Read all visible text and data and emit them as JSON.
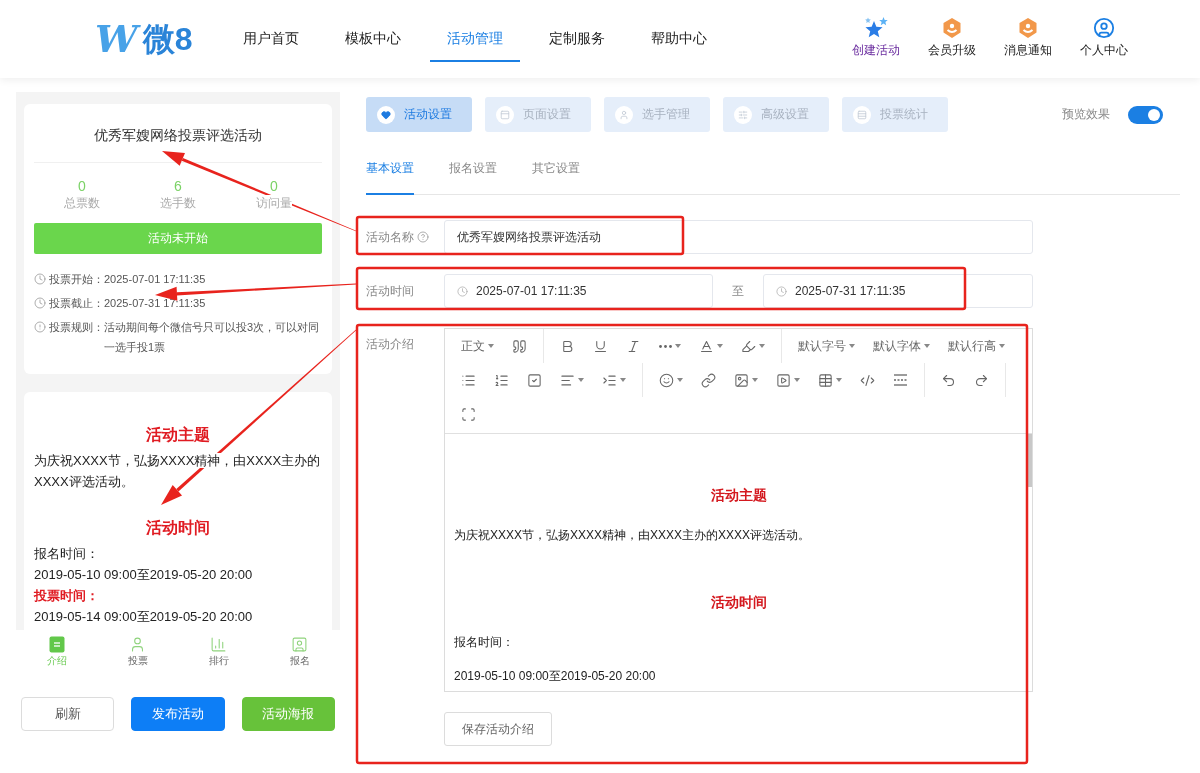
{
  "header": {
    "logo": {
      "mark": "W",
      "text": "微8"
    },
    "nav": [
      {
        "label": "用户首页",
        "selected": false
      },
      {
        "label": "模板中心",
        "selected": false
      },
      {
        "label": "活动管理",
        "selected": true
      },
      {
        "label": "定制服务",
        "selected": false
      },
      {
        "label": "帮助中心",
        "selected": false
      }
    ],
    "actions": [
      {
        "kind": "create",
        "label": "创建活动"
      },
      {
        "kind": "upgrade",
        "label": "会员升级"
      },
      {
        "kind": "notice",
        "label": "消息通知"
      },
      {
        "kind": "profile",
        "label": "个人中心"
      }
    ]
  },
  "preview": {
    "title": "优秀军嫂网络投票评选活动",
    "stats": [
      {
        "value": "0",
        "label": "总票数"
      },
      {
        "value": "6",
        "label": "选手数"
      },
      {
        "value": "0",
        "label": "访问量"
      }
    ],
    "status_button": "活动未开始",
    "info": [
      {
        "kind": "clock",
        "label": "投票开始：",
        "value": "2025-07-01 17:11:35"
      },
      {
        "kind": "clock",
        "label": "投票截止：",
        "value": "2025-07-31 17:11:35"
      },
      {
        "kind": "rule",
        "label": "投票规则：",
        "value": "活动期间每个微信号只可以投3次，可以对同一选手投1票"
      }
    ],
    "intro": [
      {
        "kind": "heading",
        "text": "活动主题"
      },
      {
        "kind": "paragraph",
        "text": "为庆祝XXXX节，弘扬XXXX精神，由XXXX主办的XXXX评选活动。"
      },
      {
        "kind": "heading",
        "text": "活动时间"
      },
      {
        "kind": "paragraph",
        "text": "报名时间："
      },
      {
        "kind": "paragraph",
        "text": "2019-05-10 09:00至2019-05-20 20:00"
      },
      {
        "kind": "emphasis",
        "text": "投票时间："
      },
      {
        "kind": "paragraph",
        "text": "2019-05-14 09:00至2019-05-20 20:00"
      }
    ],
    "tabs": [
      {
        "kind": "intro",
        "label": "介绍",
        "selected": true
      },
      {
        "kind": "vote",
        "label": "投票",
        "selected": false
      },
      {
        "kind": "rank",
        "label": "排行",
        "selected": false
      },
      {
        "kind": "signup",
        "label": "报名",
        "selected": false
      }
    ]
  },
  "preview_buttons": [
    {
      "kind": "default",
      "label": "刷新"
    },
    {
      "kind": "primary",
      "label": "发布活动"
    },
    {
      "kind": "success",
      "label": "活动海报"
    }
  ],
  "main": {
    "module_tabs": [
      {
        "kind": "activity",
        "label": "活动设置",
        "selected": true
      },
      {
        "kind": "page",
        "label": "页面设置",
        "selected": false
      },
      {
        "kind": "players",
        "label": "选手管理",
        "selected": false
      },
      {
        "kind": "advanced",
        "label": "高级设置",
        "selected": false
      },
      {
        "kind": "stats",
        "label": "投票统计",
        "selected": false
      }
    ],
    "preview_toggle": {
      "label": "预览效果",
      "on": true
    },
    "sub_tabs": [
      {
        "label": "基本设置",
        "selected": true
      },
      {
        "label": "报名设置",
        "selected": false
      },
      {
        "label": "其它设置",
        "selected": false
      }
    ],
    "form": {
      "name": {
        "label": "活动名称",
        "value": "优秀军嫂网络投票评选活动"
      },
      "time": {
        "label": "活动时间",
        "start": "2025-07-01 17:11:35",
        "separator": "至",
        "end": "2025-07-31 17:11:35"
      },
      "intro": {
        "label": "活动介绍",
        "toolbar_selects": [
          "正文",
          "默认字号",
          "默认字体",
          "默认行高"
        ],
        "content": [
          {
            "kind": "heading",
            "text": "活动主题"
          },
          {
            "kind": "paragraph",
            "text": "为庆祝XXXX节，弘扬XXXX精神，由XXXX主办的XXXX评选活动。"
          },
          {
            "kind": "heading",
            "text": "活动时间"
          },
          {
            "kind": "paragraph",
            "text": "报名时间："
          },
          {
            "kind": "paragraph",
            "text": "2019-05-10 09:00至2019-05-20 20:00"
          }
        ],
        "save_button": "保存活动介绍"
      }
    }
  }
}
